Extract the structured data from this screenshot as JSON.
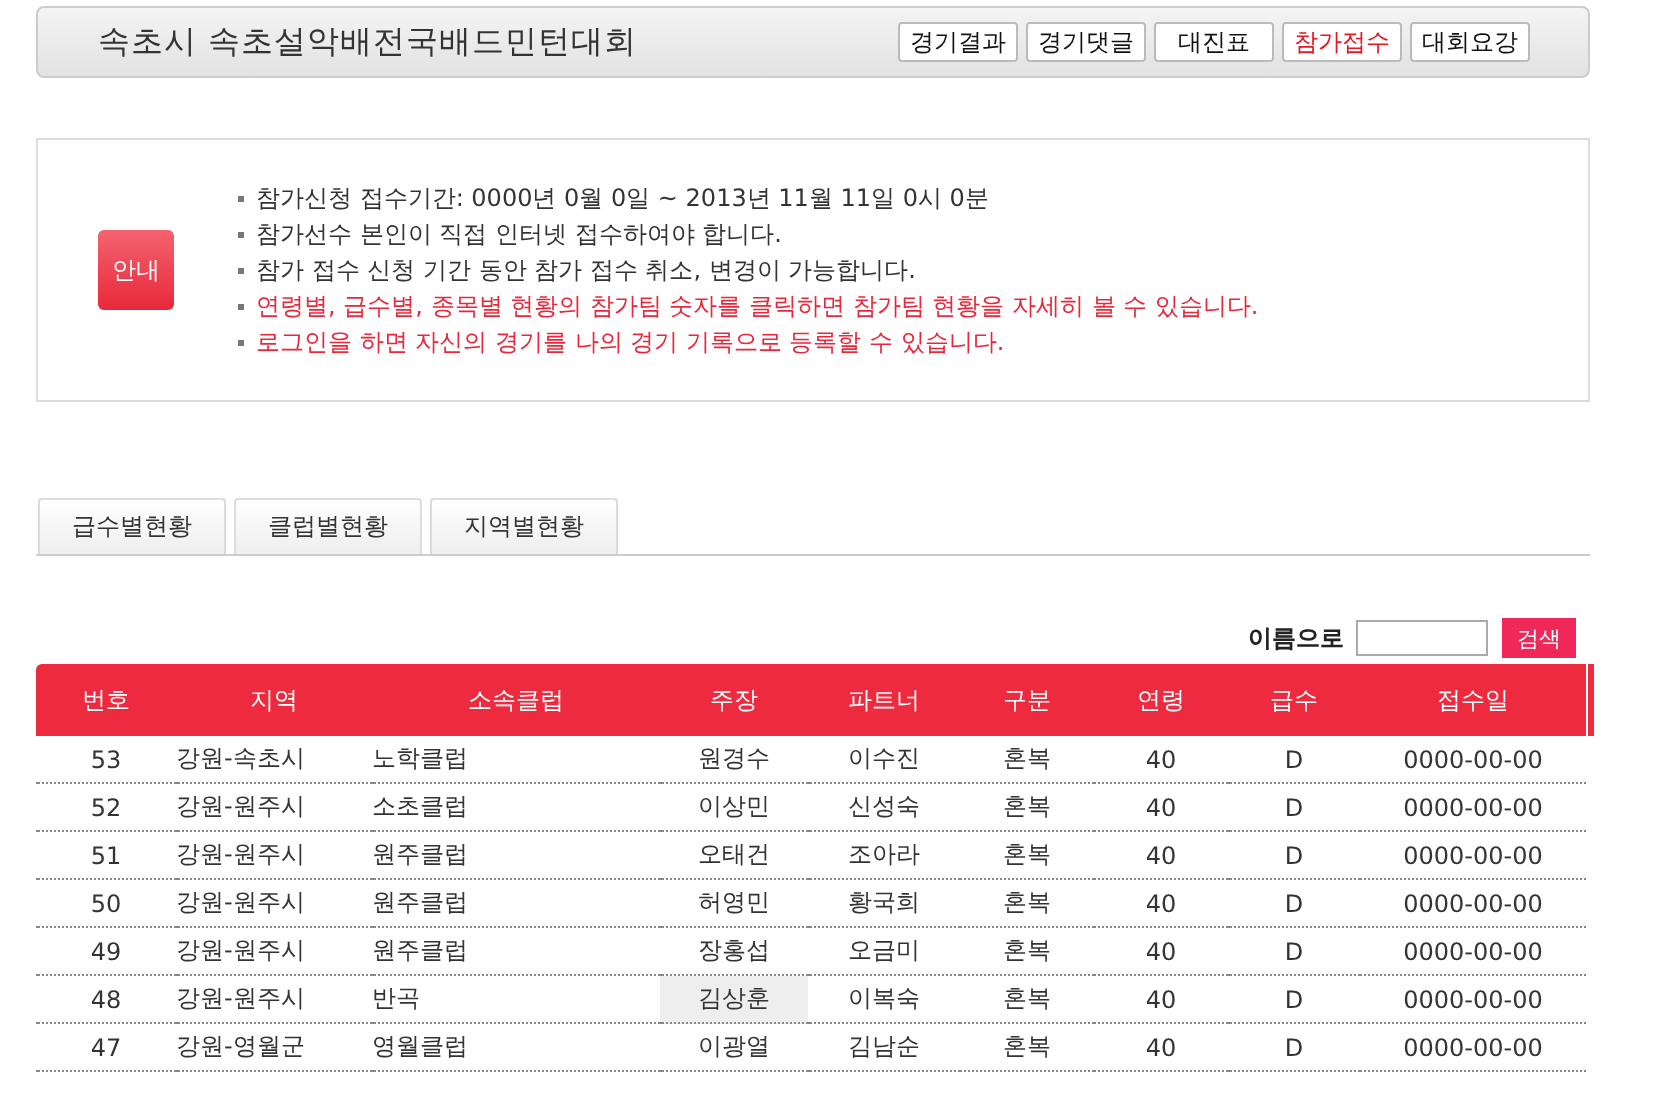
{
  "header": {
    "title": "속초시 속초설악배전국배드민턴대회",
    "menu": [
      {
        "label": "경기결과",
        "selected": false
      },
      {
        "label": "경기댓글",
        "selected": false
      },
      {
        "label": "대진표",
        "selected": false
      },
      {
        "label": "참가접수",
        "selected": true
      },
      {
        "label": "대회요강",
        "selected": false
      }
    ]
  },
  "notice": {
    "badge": "안내",
    "items": [
      {
        "text": "참가신청 접수기간: 0000년 0월 0일 ~ 2013년 11월 11일 0시 0분",
        "highlight": false
      },
      {
        "text": "참가선수 본인이 직접 인터넷 접수하여야 합니다.",
        "highlight": false
      },
      {
        "text": "참가 접수 신청 기간 동안 참가 접수 취소, 변경이 가능합니다.",
        "highlight": false
      },
      {
        "text": "연령별, 급수별, 종목별 현황의 참가팀 숫자를 클릭하면 참가팀 현황을 자세히 볼 수 있습니다.",
        "highlight": true
      },
      {
        "text": "로그인을 하면 자신의 경기를 나의 경기 기록으로 등록할 수 있습니다.",
        "highlight": true
      }
    ]
  },
  "tabs": [
    {
      "label": "급수별현황",
      "selected": false
    },
    {
      "label": "클럽별현황",
      "selected": false
    },
    {
      "label": "지역별현황",
      "selected": false
    }
  ],
  "search": {
    "label": "이름으로",
    "button": "검색"
  },
  "table": {
    "columns": [
      "번호",
      "지역",
      "소속클럽",
      "주장",
      "파트너",
      "구분",
      "연령",
      "급수",
      "접수일"
    ],
    "rows": [
      {
        "cells": [
          "53",
          "강원-속초시",
          "노학클럽",
          "원경수",
          "이수진",
          "혼복",
          "40",
          "D",
          "0000-00-00"
        ],
        "captain_highlighted": false
      },
      {
        "cells": [
          "52",
          "강원-원주시",
          "소초클럽",
          "이상민",
          "신성숙",
          "혼복",
          "40",
          "D",
          "0000-00-00"
        ],
        "captain_highlighted": false
      },
      {
        "cells": [
          "51",
          "강원-원주시",
          "원주클럽",
          "오태건",
          "조아라",
          "혼복",
          "40",
          "D",
          "0000-00-00"
        ],
        "captain_highlighted": false
      },
      {
        "cells": [
          "50",
          "강원-원주시",
          "원주클럽",
          "허영민",
          "황국희",
          "혼복",
          "40",
          "D",
          "0000-00-00"
        ],
        "captain_highlighted": false
      },
      {
        "cells": [
          "49",
          "강원-원주시",
          "원주클럽",
          "장홍섭",
          "오금미",
          "혼복",
          "40",
          "D",
          "0000-00-00"
        ],
        "captain_highlighted": false
      },
      {
        "cells": [
          "48",
          "강원-원주시",
          "반곡",
          "김상훈",
          "이복숙",
          "혼복",
          "40",
          "D",
          "0000-00-00"
        ],
        "captain_highlighted": true
      },
      {
        "cells": [
          "47",
          "강원-영월군",
          "영월클럽",
          "이광열",
          "김남순",
          "혼복",
          "40",
          "D",
          "0000-00-00"
        ],
        "captain_highlighted": false
      }
    ]
  }
}
